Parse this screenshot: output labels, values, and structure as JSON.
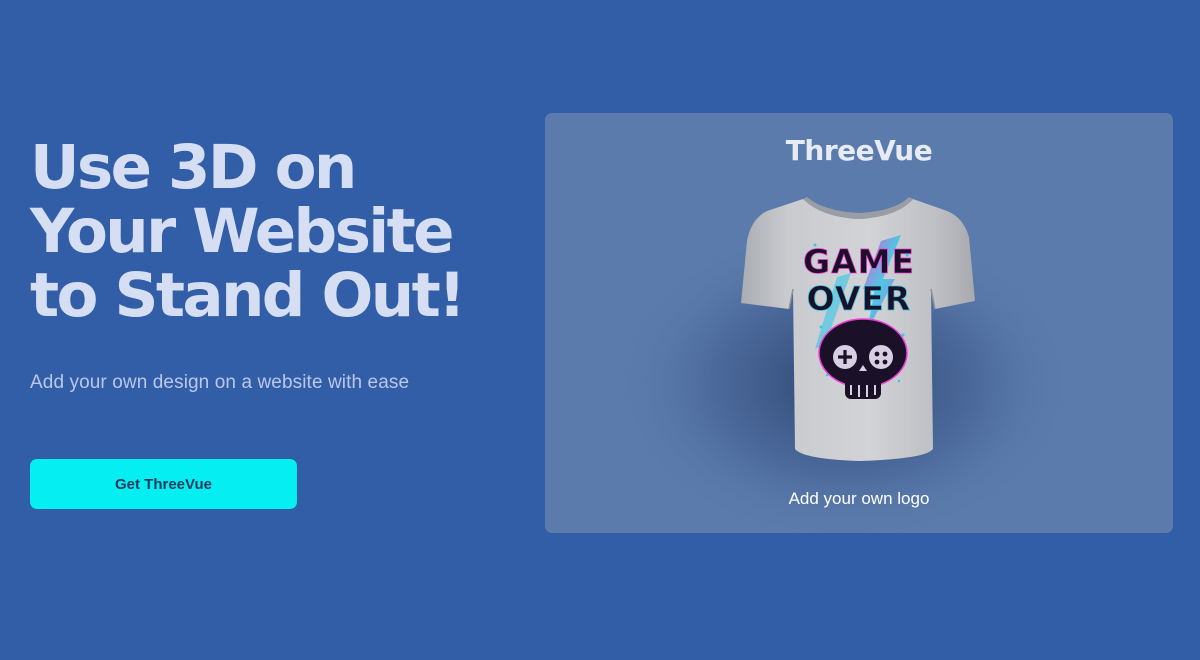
{
  "hero": {
    "headline": "Use 3D on\nYour Website\nto Stand Out!",
    "subtitle": "Add your own design on a website with ease",
    "cta_label": "Get ThreeVue"
  },
  "preview": {
    "title": "ThreeVue",
    "shirt_print_line1": "GAME",
    "shirt_print_line2": "OVER",
    "caption": "Add your own logo"
  },
  "colors": {
    "background": "#325ea8",
    "card": "#5b7bad",
    "accent": "#05eef2",
    "shirt": "#c4c6ca"
  },
  "icons": {
    "model": "tshirt-3d-model",
    "print": "skull-gamepad-icon"
  }
}
